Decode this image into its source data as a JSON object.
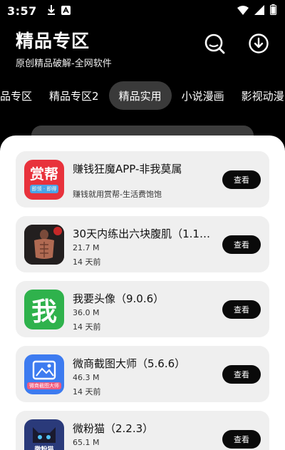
{
  "status_bar": {
    "time": "3:57"
  },
  "header": {
    "title": "精品专区",
    "subtitle": "原创精品破解-全网软件"
  },
  "tabs": [
    {
      "label": "品专区"
    },
    {
      "label": "精品专区2"
    },
    {
      "label": "精品实用",
      "active": true
    },
    {
      "label": "小说漫画"
    },
    {
      "label": "影视动漫"
    }
  ],
  "apps": [
    {
      "name": "赚钱狂魔APP-非我莫属",
      "desc": "赚钱就用赏帮-生活费饱饱",
      "button": "查看",
      "icon": "shangbang-app-icon"
    },
    {
      "name": "30天内练出六块腹肌（1.1....",
      "size": "21.7 M",
      "date": "14 天前",
      "button": "查看",
      "icon": "fitness-app-icon"
    },
    {
      "name": "我要头像（9.0.6）",
      "size": "36.0 M",
      "date": "14 天前",
      "button": "查看",
      "icon": "avatar-app-icon",
      "icon_text": "我"
    },
    {
      "name": "微商截图大师（5.6.6）",
      "size": "46.3 M",
      "date": "14 天前",
      "button": "查看",
      "icon": "screenshot-app-icon"
    },
    {
      "name": "微粉猫（2.2.3）",
      "size": "65.1 M",
      "date": "",
      "button": "查看",
      "icon": "cat-app-icon"
    }
  ],
  "icon_texts": {
    "shangbang": "赏帮",
    "shangbang_small": "即领 · 即得",
    "screenshot_label": "微商截图大师",
    "cat_label": "微粉猫"
  },
  "colors": {
    "background": "#000000",
    "sheet": "#ffffff",
    "card": "#efefef",
    "button": "#0a0a0a",
    "avatar_green": "#2fb24c"
  }
}
